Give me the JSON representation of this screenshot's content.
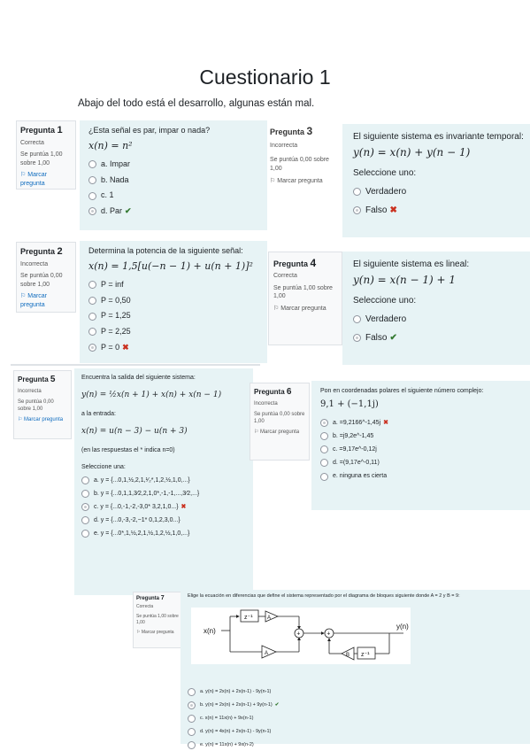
{
  "page": {
    "title": "Cuestionario 1",
    "subtitle": "Abajo del todo está el desarrollo, algunas están mal."
  },
  "q1": {
    "info": {
      "label": "Pregunta",
      "num": "1",
      "state": "Correcta",
      "mark": "Se puntúa 1,00 sobre 1,00",
      "flag": "Marcar pregunta"
    },
    "text": "¿Esta señal es par, impar o nada?",
    "formula": "x(n) = n²",
    "options": [
      {
        "label": "a. Impar",
        "checked": false,
        "mark": ""
      },
      {
        "label": "b. Nada",
        "checked": false,
        "mark": ""
      },
      {
        "label": "c. 1",
        "checked": false,
        "mark": ""
      },
      {
        "label": "d. Par",
        "checked": true,
        "mark": "correct"
      }
    ]
  },
  "q2": {
    "info": {
      "label": "Pregunta",
      "num": "2",
      "state": "Incorrecta",
      "mark": "Se puntúa 0,00 sobre 1,00",
      "flag": "Marcar pregunta"
    },
    "text": "Determina la potencia de la siguiente señal:",
    "formula": "x(n) = 1,5[u(−n − 1) + u(n + 1)]²",
    "options": [
      {
        "label": "P = inf",
        "checked": false,
        "mark": ""
      },
      {
        "label": "P = 0,50",
        "checked": false,
        "mark": ""
      },
      {
        "label": "P = 1,25",
        "checked": false,
        "mark": ""
      },
      {
        "label": "P = 2,25",
        "checked": false,
        "mark": ""
      },
      {
        "label": "P = 0",
        "checked": true,
        "mark": "wrong"
      }
    ]
  },
  "q3": {
    "info": {
      "label": "Pregunta",
      "num": "3",
      "state": "Incorrecta",
      "mark": "Se puntúa 0,00 sobre 1,00",
      "flag": "Marcar pregunta"
    },
    "text": "El siguiente sistema es invariante temporal:",
    "formula": "y(n) = x(n) + y(n − 1)",
    "select": "Seleccione uno:",
    "options": [
      {
        "label": "Verdadero",
        "checked": false,
        "mark": ""
      },
      {
        "label": "Falso",
        "checked": true,
        "mark": "wrong"
      }
    ]
  },
  "q4": {
    "info": {
      "label": "Pregunta",
      "num": "4",
      "state": "Correcta",
      "mark": "Se puntúa 1,00 sobre 1,00",
      "flag": "Marcar pregunta"
    },
    "text": "El siguiente sistema es lineal:",
    "formula": "y(n) = x(n − 1) + 1",
    "select": "Seleccione uno:",
    "options": [
      {
        "label": "Verdadero",
        "checked": false,
        "mark": ""
      },
      {
        "label": "Falso",
        "checked": true,
        "mark": "correct"
      }
    ]
  },
  "q5": {
    "info": {
      "label": "Pregunta",
      "num": "5",
      "state": "Incorrecta",
      "mark": "Se puntúa 0,00 sobre 1,00",
      "flag": "Marcar pregunta"
    },
    "text": "Encuentra la salida del siguiente sistema:",
    "formula1": "y(n) = ½x(n + 1) + x(n) + x(n − 1)",
    "text2": "a la entrada:",
    "formula2": "x(n) = u(n − 3) − u(n + 3)",
    "text3": "(en las respuestas el * indica n=0)",
    "select": "Seleccione una:",
    "options": [
      {
        "label": "a.  y = {...0,1,½,2,1,¹⁄₂*,1,2,½,1,0,...}",
        "checked": false,
        "mark": ""
      },
      {
        "label": "b.  y = {...0,1,1,3⁄2,2,1,0*,-1,-1,...,3⁄2,...}",
        "checked": false,
        "mark": ""
      },
      {
        "label": "c.  y = {...0,-1,-2,-3,0* 3,2,1,0...}",
        "checked": true,
        "mark": "wrong"
      },
      {
        "label": "d.  y = {...0,-3,-2,−1* 0,1,2,3,0...}",
        "checked": false,
        "mark": ""
      },
      {
        "label": "e.  y = {...0*,1,½,2,1,½,1,2,½,1,0,...}",
        "checked": false,
        "mark": ""
      }
    ]
  },
  "q6": {
    "info": {
      "label": "Pregunta",
      "num": "6",
      "state": "Incorrecta",
      "mark": "Se puntúa 0,00 sobre 1,00",
      "flag": "Marcar pregunta"
    },
    "text": "Pon en coordenadas polares el siguiente número complejo:",
    "formula": "9,1 + (−1,1j)",
    "options": [
      {
        "label": "a. =9,2166^-1,45j",
        "checked": true,
        "mark": "wrong"
      },
      {
        "label": "b. =j9,2e^-1,45",
        "checked": false,
        "mark": ""
      },
      {
        "label": "c. =9,17e^-0,12j",
        "checked": false,
        "mark": ""
      },
      {
        "label": "d. =(9,17e^-0,11)",
        "checked": false,
        "mark": ""
      },
      {
        "label": "e. ninguna es cierta",
        "checked": false,
        "mark": ""
      }
    ]
  },
  "q7": {
    "info": {
      "label": "Pregunta",
      "num": "7",
      "state": "Correcta",
      "mark": "Se puntúa 1,00 sobre 1,00",
      "flag": "Marcar pregunta"
    },
    "text": "Elige la ecuación en diferencias que define el sistema representado por el diagrama de bloques siguiente donde A = 2 y B = 9:",
    "diagram": {
      "input": "x(n)",
      "output": "y(n)",
      "delay": "z⁻¹",
      "gainA": "A",
      "gainB": "B"
    },
    "options": [
      {
        "label": "a. y(n) = 2x(n) + 2x(n-1) - 9y(n-1)",
        "checked": false,
        "mark": ""
      },
      {
        "label": "b. y(n) = 2x(n) + 2x(n-1) + 9y(n-1)",
        "checked": true,
        "mark": "correct"
      },
      {
        "label": "c. x(n) = 11x(n) + 9x(n-1)",
        "checked": false,
        "mark": ""
      },
      {
        "label": "d. y(n) = 4x(n) + 2x(n-1) - 9y(n-1)",
        "checked": false,
        "mark": ""
      },
      {
        "label": "e. y(n) = 11x(n) + 9x(n-2)",
        "checked": false,
        "mark": ""
      }
    ]
  }
}
